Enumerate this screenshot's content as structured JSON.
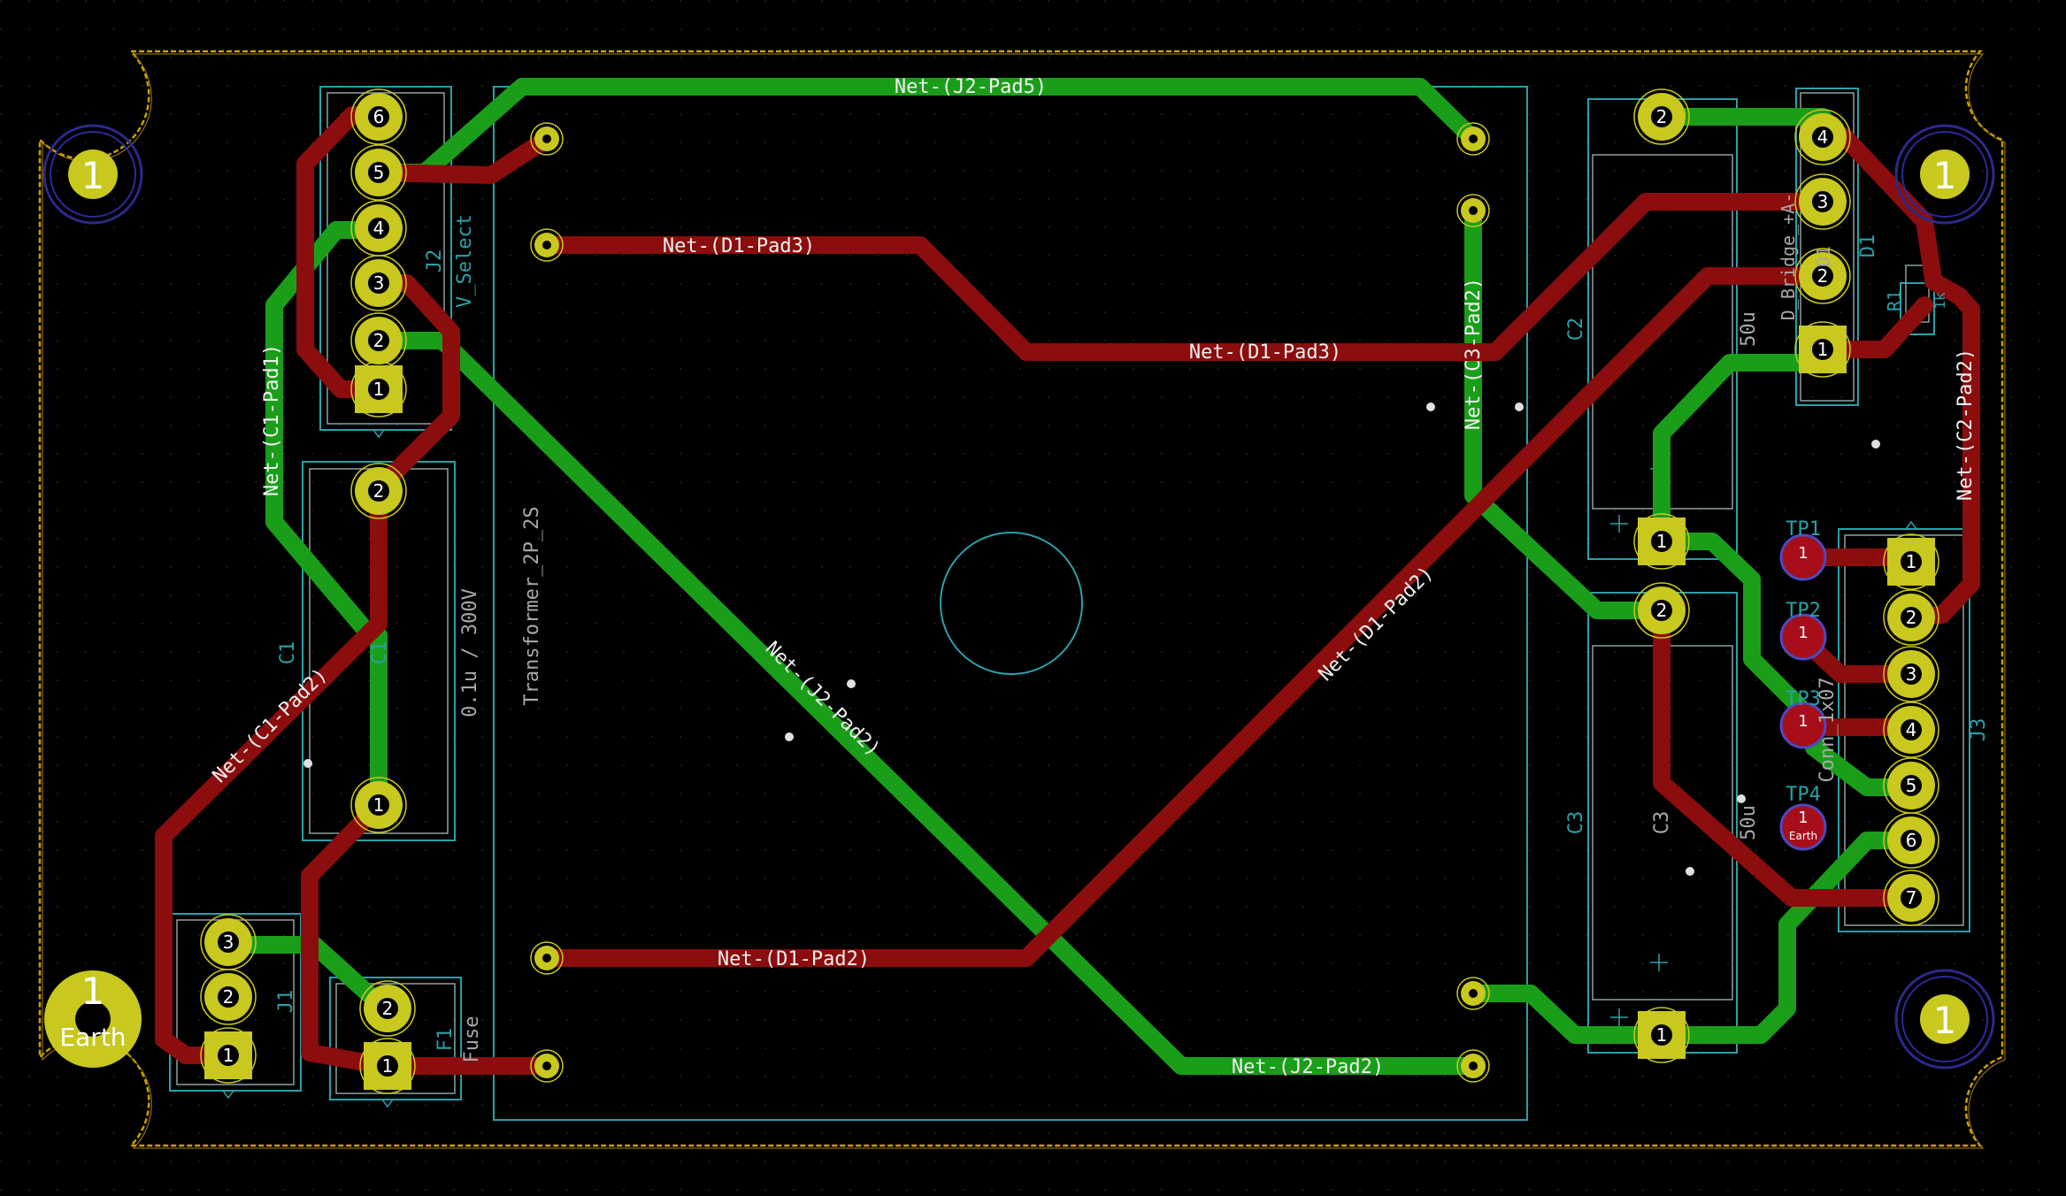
{
  "net_labels": {
    "j2_pad5": "Net-(J2-Pad5)",
    "d1_pad3_top": "Net-(D1-Pad3)",
    "d1_pad3_mid": "Net-(D1-Pad3)",
    "c1_pad1": "Net-(C1-Pad1)",
    "c1_pad2": "Net-(C1-Pad2)",
    "j2_pad2_diag": "Net-(J2-Pad2)",
    "d1_pad2_diag": "Net-(D1-Pad2)",
    "d1_pad2_bottom": "Net-(D1-Pad2)",
    "j2_pad2_bottom": "Net-(J2-Pad2)",
    "c_pad2_vert": "Net-(C3-Pad2)",
    "c2_pad2": "Net-(C2-Pad2)"
  },
  "silkscreen": {
    "j2_ref": "J2",
    "j2_value": "V_Select",
    "transformer": "Transformer_2P_2S",
    "c1_ref": "C1",
    "c1_ref_fab": "C1",
    "c1_value": "0.1u / 300V",
    "j1_ref": "J1",
    "f1_ref": "F1",
    "f1_value": "Fuse",
    "c2_ref": "C2",
    "c2_value": "50u",
    "c3_ref": "C3",
    "c3_ref_fab": "C3",
    "c3_value": "50u",
    "d1_ref": "D1",
    "d1_ref_fab": "D1",
    "d1_value": "D_Bridge_+A-",
    "r1_ref": "R1",
    "r1_value": "1k",
    "j3_ref": "J3",
    "j3_value": "Conn_1x07",
    "tp1": "TP1",
    "tp2": "TP2",
    "tp3": "TP3",
    "tp4": "TP4",
    "tp4_name": "Earth",
    "earth": "Earth"
  },
  "pad_numbers": {
    "one": "1",
    "two": "2",
    "three": "3",
    "four": "4",
    "five": "5",
    "six": "6",
    "seven": "7"
  },
  "colors": {
    "background": "#000000",
    "top_copper": "#8b0d0d",
    "bottom_copper": "#1a9e1a",
    "pad": "#c8c81e",
    "silkscreen": "#2aa0a8",
    "edge_cuts": "#c8a000"
  }
}
